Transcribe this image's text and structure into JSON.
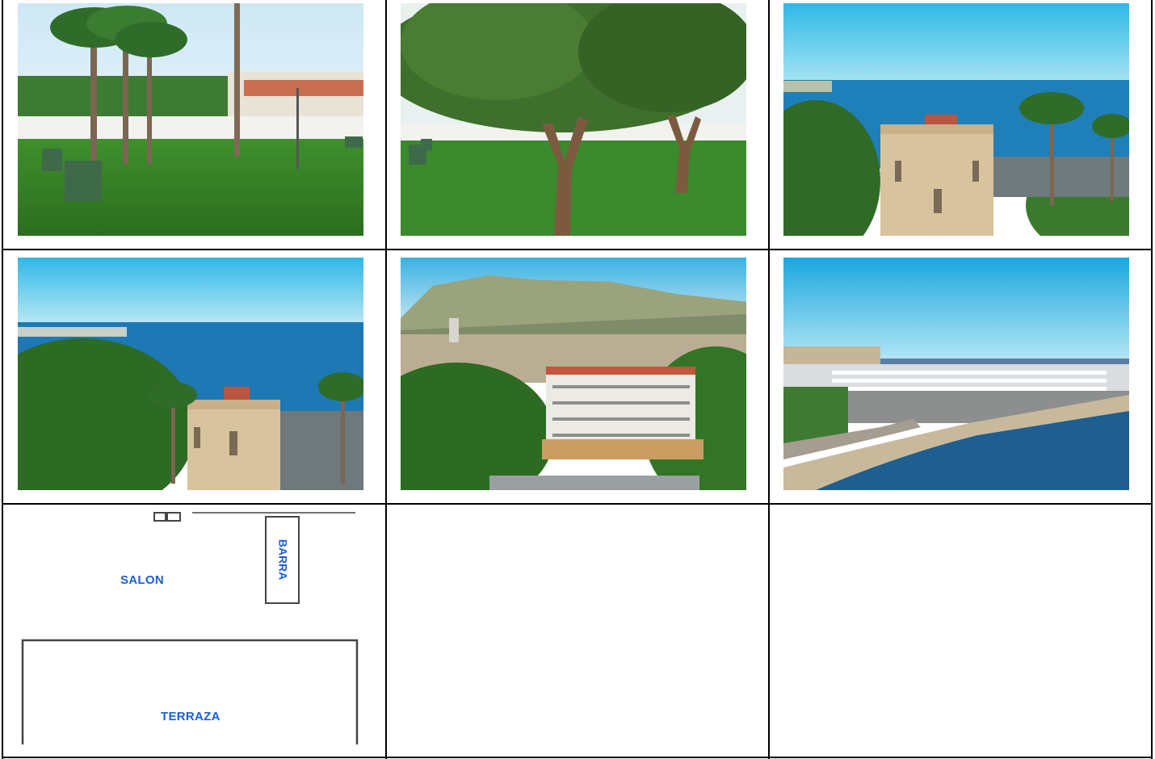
{
  "photos": [
    {
      "name": "garden-palms-photo",
      "scene": "garden lawn with palm trees and benches"
    },
    {
      "name": "garden-trees-photo",
      "scene": "garden lawn with pepper trees"
    },
    {
      "name": "tower-sea-photo",
      "scene": "tower building overlooking the sea"
    },
    {
      "name": "tower-bay-photo",
      "scene": "tower and bay view with pines"
    },
    {
      "name": "mountain-hotel-photo",
      "scene": "hotel building with mountain behind"
    },
    {
      "name": "marina-photo",
      "scene": "marina and breakwater aerial view"
    }
  ],
  "floor_plan": {
    "salon_label": "SALON",
    "barra_label": "BARRA",
    "terraza_label": "TERRAZA"
  },
  "colors": {
    "label_blue": "#1a5fd6",
    "plan_line": "#444444",
    "grid_line": "#000000"
  }
}
